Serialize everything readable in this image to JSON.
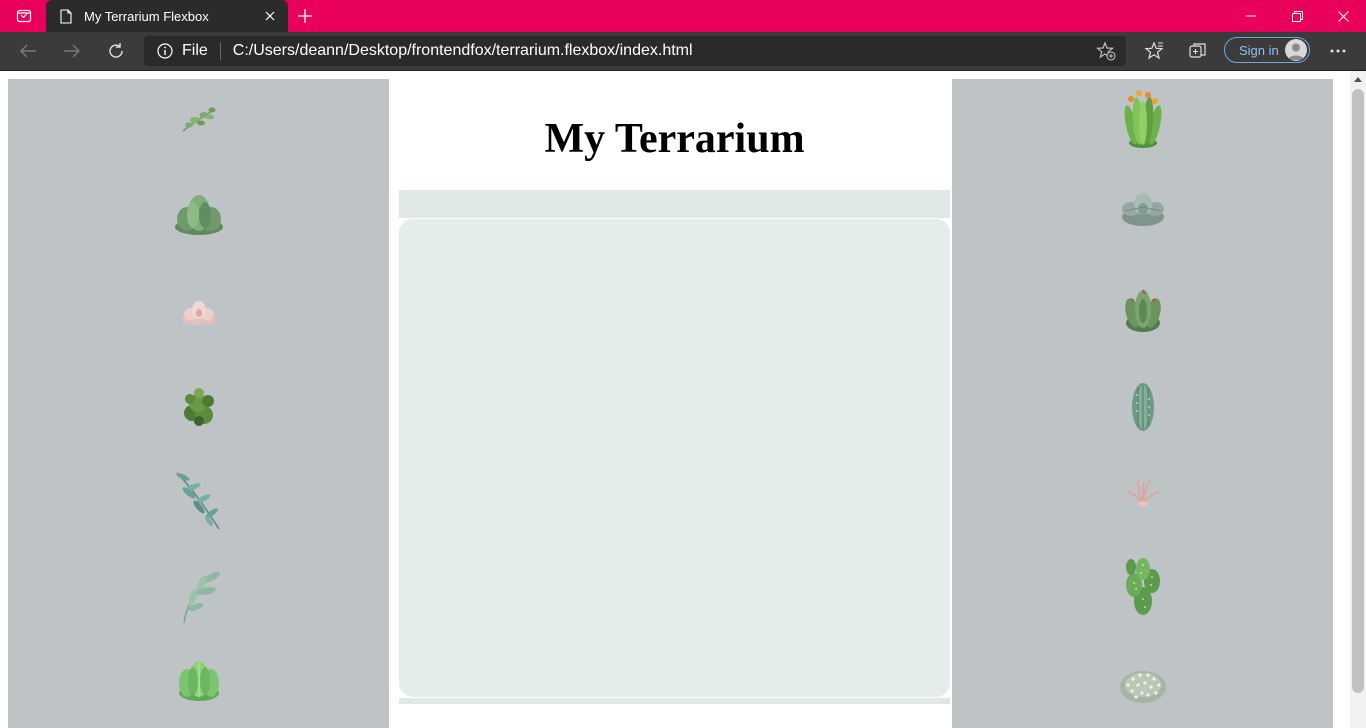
{
  "browser": {
    "tab": {
      "title": "My Terrarium Flexbox",
      "icon": "page-icon"
    },
    "address": {
      "scheme": "File",
      "url": "C:/Users/deann/Desktop/frontendfox/terrarium.flexbox/index.html"
    },
    "signin_label": "Sign in",
    "accent": "#e8005a"
  },
  "page": {
    "title": "My Terrarium",
    "left_plants": [
      "fern-sprig",
      "green-succulent-rosette",
      "pink-succulent",
      "dark-green-moss-clump",
      "eucalyptus-branch",
      "sage-branch",
      "bright-green-succulent"
    ],
    "right_plants": [
      "flowering-aloe",
      "grey-echeveria",
      "red-tipped-succulent",
      "striped-cactus",
      "air-plant",
      "prickly-pear-cactus",
      "white-dotted-cactus"
    ],
    "colors": {
      "column_bg": "#bec3c6",
      "jar_bg": "#e4edec"
    }
  }
}
